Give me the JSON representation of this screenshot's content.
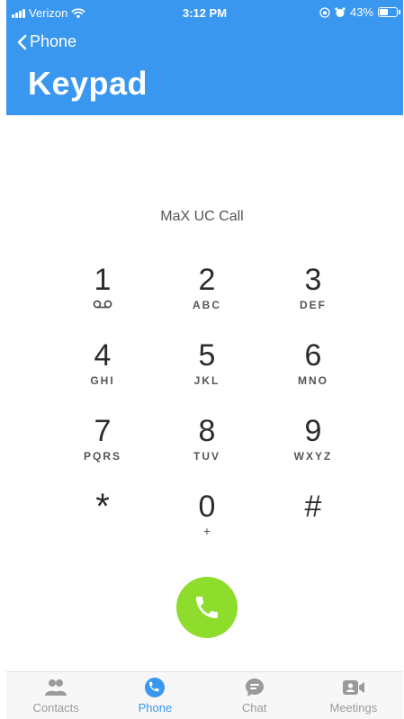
{
  "status_bar": {
    "carrier": "Verizon",
    "time": "3:12 PM",
    "battery_percent": "43%",
    "battery_level": 0.43
  },
  "header": {
    "back_label": "Phone",
    "title": "Keypad"
  },
  "call_label": "MaX UC Call",
  "keys": [
    {
      "digit": "1",
      "sub": ""
    },
    {
      "digit": "2",
      "sub": "ABC"
    },
    {
      "digit": "3",
      "sub": "DEF"
    },
    {
      "digit": "4",
      "sub": "GHI"
    },
    {
      "digit": "5",
      "sub": "JKL"
    },
    {
      "digit": "6",
      "sub": "MNO"
    },
    {
      "digit": "7",
      "sub": "PQRS"
    },
    {
      "digit": "8",
      "sub": "TUV"
    },
    {
      "digit": "9",
      "sub": "WXYZ"
    },
    {
      "digit": "*",
      "sub": ""
    },
    {
      "digit": "0",
      "sub": "+"
    },
    {
      "digit": "#",
      "sub": ""
    }
  ],
  "tabs": [
    {
      "label": "Contacts",
      "icon": "contacts-icon"
    },
    {
      "label": "Phone",
      "icon": "phone-icon"
    },
    {
      "label": "Chat",
      "icon": "chat-icon"
    },
    {
      "label": "Meetings",
      "icon": "video-icon"
    }
  ],
  "active_tab": "Phone",
  "colors": {
    "header_blue": "#3a97f0",
    "call_green": "#8edc2c",
    "inactive_gray": "#9a9a9a"
  }
}
